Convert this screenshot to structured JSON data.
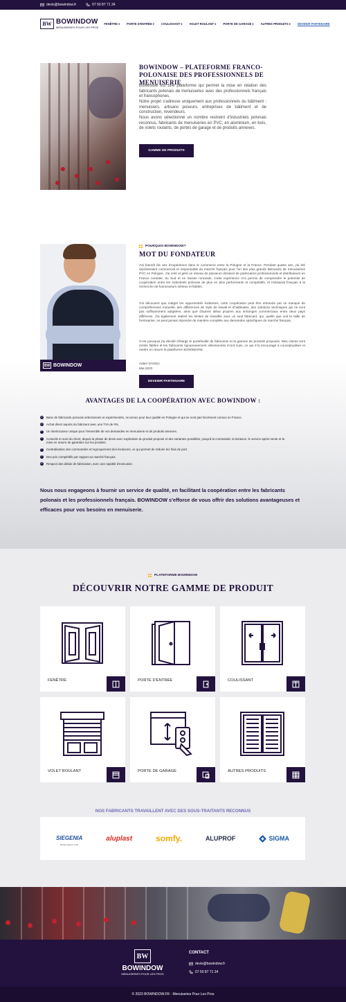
{
  "topbar": {
    "email": "devis@bowindow.fr",
    "phone": "07 50 87 71 34"
  },
  "brand": {
    "logo_letters": "BW",
    "name": "BOWINDOW",
    "tagline": "MENUISERIES POUR LES PROS"
  },
  "nav": {
    "items": [
      {
        "label": "FENÊTRE"
      },
      {
        "label": "PORTE D'ENTRÉE"
      },
      {
        "label": "COULISSANT"
      },
      {
        "label": "VOLET ROULANT"
      },
      {
        "label": "PORTE DE GARAGE"
      },
      {
        "label": "AUTRES PRODUITS"
      }
    ],
    "partner": "DEVENIR PARTENAIRE"
  },
  "intro": {
    "title": "BOWINDOW – PLATEFORME FRANCO-POLONAISE DES PROFESSIONNELS DE MENUISERIE",
    "p1": "Bowindow est une plateforme qui permet la mise en relation des fabricants polonais de menuiseries avec des professionnels français et francophones.",
    "p2": "Notre projet s'adresse uniquement aux professionnels du bâtiment : menuisiers, artisans poseurs, entreprises de bâtiment et de construction, revendeurs.",
    "p3": "Nous avons sélectionné un nombre restreint d'industriels polonais reconnus, fabricants de menuiseries en PVC, en aluminium, en bois, de volets roulants, de portes de garage et de produits annexes.",
    "button": "GAMME DE PRODUITS"
  },
  "founder": {
    "kicker": "POURQUOI BOWINDOW?",
    "title": "MOT DU FONDATEUR",
    "p1": "J'ai bientôt dix ans d'expérience dans le commerce entre la Pologne et la France. Pendant quatre ans, j'ai été représentant commercial et responsable du marché français pour l'un des plus grands fabricants de menuiseries PVC en Pologne. J'ai créé et géré un réseau de plusieurs dizaines de partenaires professionnels et distributeurs en France centrale, du Sud et en Suisse romande. Cette expérience m'a permis de comprendre le potentiel de coopération entre les industriels polonais de plus en plus performants et compétitifs, et l'artisanat français à la recherche de fournisseurs sérieux et fiables.",
    "p2": "J'ai découvert que malgré les opportunités évidentes, cette coopération peut être entravée par un manque de compréhension mutuelle, des différences de style de travail et d'habitudes, des solutions techniques qui ne sont pas suffisamment adaptées, ainsi que d'autres aléas propres aux échanges commerciaux entre deux pays différents. J'ai également réalisé les limites de travailler avec un seul fabricant, qui, quelle que soit la taille de l'entreprise, ne peut jamais répondre de manière complète aux demandes spécifiques du marché français.",
    "p3": "C'est pourquoi j'ai décidé d'élargir le portefeuille de fabricants et la gamme de produits proposés. Mes clients sont restés fidèles et les fabricants rigoureusement sélectionnés m'ont suivi, ce qui m'a encouragé à conceptualiser et mettre en œuvre la plateforme BOWINDOW.",
    "signature": "Adam DASSU",
    "date": "Mai 2023",
    "button": "DEVENIR PARTENAIRE",
    "photo_band": "BOWINDOW"
  },
  "advantages": {
    "title": "AVANTAGES DE LA COOPÉRATION AVEC BOWINDOW :",
    "items": [
      "Base de fabricants polonais sélectionnés et expérimentés, reconnus pour leur qualité en Pologne et qui ne sont pas forcément connus en France.",
      "Achat direct auprès du fabricant avec une TVA de 0%.",
      "Un interlocuteur unique pour l'ensemble de vos demandes en menuiserie et de produits annexes.",
      "Conseils et suivi du client, depuis la phase de devis avec explication du produit proposé et des variantes possibles, jusqu'à la commande, la livraison, le service après-vente et la mise en œuvre de garanties sur les produits.",
      "Centralisation des commandes et regroupement des livraisons, ce qui permet de réduire les frais de port.",
      "Des prix compétitifs par rapport au marché français.",
      "Respect des délais de fabrication, avec une rapidité d'exécution."
    ],
    "closing": "Nous nous engageons à fournir un service de qualité, en facilitant la coopération entre les fabricants polonais et les professionnels français. BOWINDOW s'efforce de vous offrir des solutions avantageuses et efficaces pour vos besoins en menuiserie."
  },
  "products": {
    "kicker": "PLATEFORME BOWINDOW",
    "title": "DÉCOUVRIR NOTRE GAMME DE PRODUIT",
    "cards": [
      {
        "label": "FENÊTRE",
        "icon": "window-icon"
      },
      {
        "label": "PORTE D'ENTRÉE",
        "icon": "door-icon"
      },
      {
        "label": "COULISSANT",
        "icon": "sliding-door-icon"
      },
      {
        "label": "VOLET ROULANT",
        "icon": "roller-shutter-icon"
      },
      {
        "label": "PORTE DE GARAGE",
        "icon": "garage-door-icon"
      },
      {
        "label": "AUTRES PRODUITS",
        "icon": "shutters-icon"
      }
    ]
  },
  "manufacturers": {
    "title": "NOS FABRICANTS TRAVAILLENT AVEC DES SOUS-TRAITANTS RECONNUS",
    "logos": [
      {
        "name": "SIEGENIA",
        "sub": "Bringt spaces to life",
        "color": "#1d4e9e"
      },
      {
        "name": "aluplast",
        "sub": "",
        "color": "#d7261e"
      },
      {
        "name": "somfy.",
        "sub": "",
        "color": "#f2a900"
      },
      {
        "name": "ALUPROF",
        "sub": "",
        "color": "#1f2a44"
      },
      {
        "name": "SIGMA",
        "sub": "",
        "color": "#1c5aa6"
      }
    ]
  },
  "footer": {
    "contact_title": "CONTACT",
    "email": "devis@bowindow.fr",
    "phone": "07 50 87 71 34",
    "copyright": "© 2023 BOWINDOW.FR - Menuiseries Pour Les Pros"
  }
}
